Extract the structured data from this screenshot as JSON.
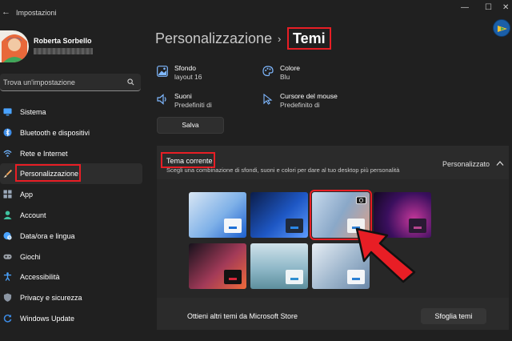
{
  "window": {
    "app_title": "Impostazioni",
    "back_glyph": "←",
    "minimize_glyph": "—",
    "maximize_glyph": "☐",
    "close_glyph": "✕"
  },
  "user": {
    "name": "Roberta Sorbello"
  },
  "search": {
    "placeholder": "Trova un'impostazione"
  },
  "sidebar": {
    "items": [
      {
        "label": "Sistema",
        "icon": "monitor-icon",
        "color": "#4aa3ff"
      },
      {
        "label": "Bluetooth e dispositivi",
        "icon": "bluetooth-icon",
        "color": "#3d8de8"
      },
      {
        "label": "Rete e Internet",
        "icon": "wifi-icon",
        "color": "#6fb3ff"
      },
      {
        "label": "Personalizzazione",
        "icon": "brush-icon",
        "color": "#f0a35a",
        "active": true
      },
      {
        "label": "App",
        "icon": "apps-icon",
        "color": "#9aa7b8"
      },
      {
        "label": "Account",
        "icon": "person-icon",
        "color": "#3fc2a0"
      },
      {
        "label": "Data/ora e lingua",
        "icon": "globe-clock-icon",
        "color": "#4aa3ff"
      },
      {
        "label": "Giochi",
        "icon": "gamepad-icon",
        "color": "#9aa0a8"
      },
      {
        "label": "Accessibilità",
        "icon": "accessibility-icon",
        "color": "#4aa3ff"
      },
      {
        "label": "Privacy e sicurezza",
        "icon": "shield-icon",
        "color": "#8b95a3"
      },
      {
        "label": "Windows Update",
        "icon": "update-icon",
        "color": "#3d8de8"
      }
    ]
  },
  "header": {
    "breadcrumb_parent": "Personalizzazione",
    "breadcrumb_separator": "›",
    "breadcrumb_current": "Temi"
  },
  "theme_props": {
    "background": {
      "title": "Sfondo",
      "value": "layout 16"
    },
    "color": {
      "title": "Colore",
      "value": "Blu"
    },
    "sounds": {
      "title": "Suoni",
      "value": "Predefiniti di"
    },
    "cursor": {
      "title": "Cursore del mouse",
      "value": "Predefinito di"
    }
  },
  "save_label": "Salva",
  "current_theme": {
    "title": "Tema corrente",
    "description": "Scegli una combinazione di sfondi, suoni e colori per dare al tuo desktop più personalità",
    "status": "Personalizzato",
    "thumbnails": [
      {
        "name": "windows-light",
        "bg": "linear-gradient(135deg,#d8e6f4,#7fb1e8 55%,#1c5fcf)",
        "win": "#f4f6f9",
        "bar": "#1e6fd6"
      },
      {
        "name": "windows-dark",
        "bg": "linear-gradient(135deg,#0b1d4a,#1e57c4 55%,#5c9bff)",
        "win": "#1f2a3d",
        "bar": "#2a87e8"
      },
      {
        "name": "spotlight",
        "bg": "linear-gradient(120deg,#c7d9ec,#8aa8c8 50%,#d9a08a)",
        "win": "#f2f2f2",
        "bar": "#2f7fd1",
        "selected": true
      },
      {
        "name": "glow",
        "bg": "radial-gradient(circle at 70% 60%,#c4379a,#3a0f5e 55%,#12081f)",
        "win": "#2a1a33",
        "bar": "#b7468f"
      },
      {
        "name": "captured-motion",
        "bg": "linear-gradient(135deg,#16121c,#a23a58 55%,#f06a3a)",
        "win": "#121212",
        "bar": "#d6263a"
      },
      {
        "name": "sunrise",
        "bg": "linear-gradient(180deg,#cfe2ea,#8fb8c8 55%,#5d8f9d)",
        "win": "#eef4f6",
        "bar": "#2e8ed0"
      },
      {
        "name": "flow",
        "bg": "linear-gradient(135deg,#e6edf4,#9db5cc 55%,#6a87a8)",
        "win": "#f4f6f9",
        "bar": "#2a7fd4"
      }
    ]
  },
  "store": {
    "text": "Ottieni altri temi da Microsoft Store",
    "button": "Sfoglia temi"
  },
  "colors": {
    "annotation_red": "#e81e25",
    "accent": "#4aa3ff"
  }
}
